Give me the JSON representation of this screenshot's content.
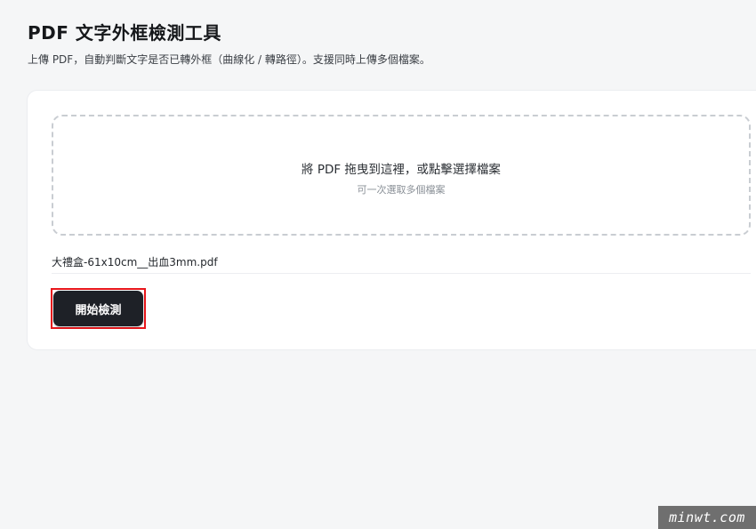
{
  "header": {
    "title": "PDF 文字外框檢測工具",
    "subtitle": "上傳 PDF，自動判斷文字是否已轉外框（曲線化 / 轉路徑）。支援同時上傳多個檔案。"
  },
  "upload": {
    "drop_text": "將 PDF 拖曳到這裡，或點擊選擇檔案",
    "drop_hint": "可一次選取多個檔案"
  },
  "files": [
    {
      "name": "大禮盒-61x10cm__出血3mm.pdf"
    }
  ],
  "actions": {
    "start_label": "開始檢測"
  },
  "watermark": {
    "text": "minwt.com"
  },
  "colors": {
    "button_bg": "#1e2127",
    "highlight": "#e8161b",
    "page_bg": "#f5f6f7"
  }
}
